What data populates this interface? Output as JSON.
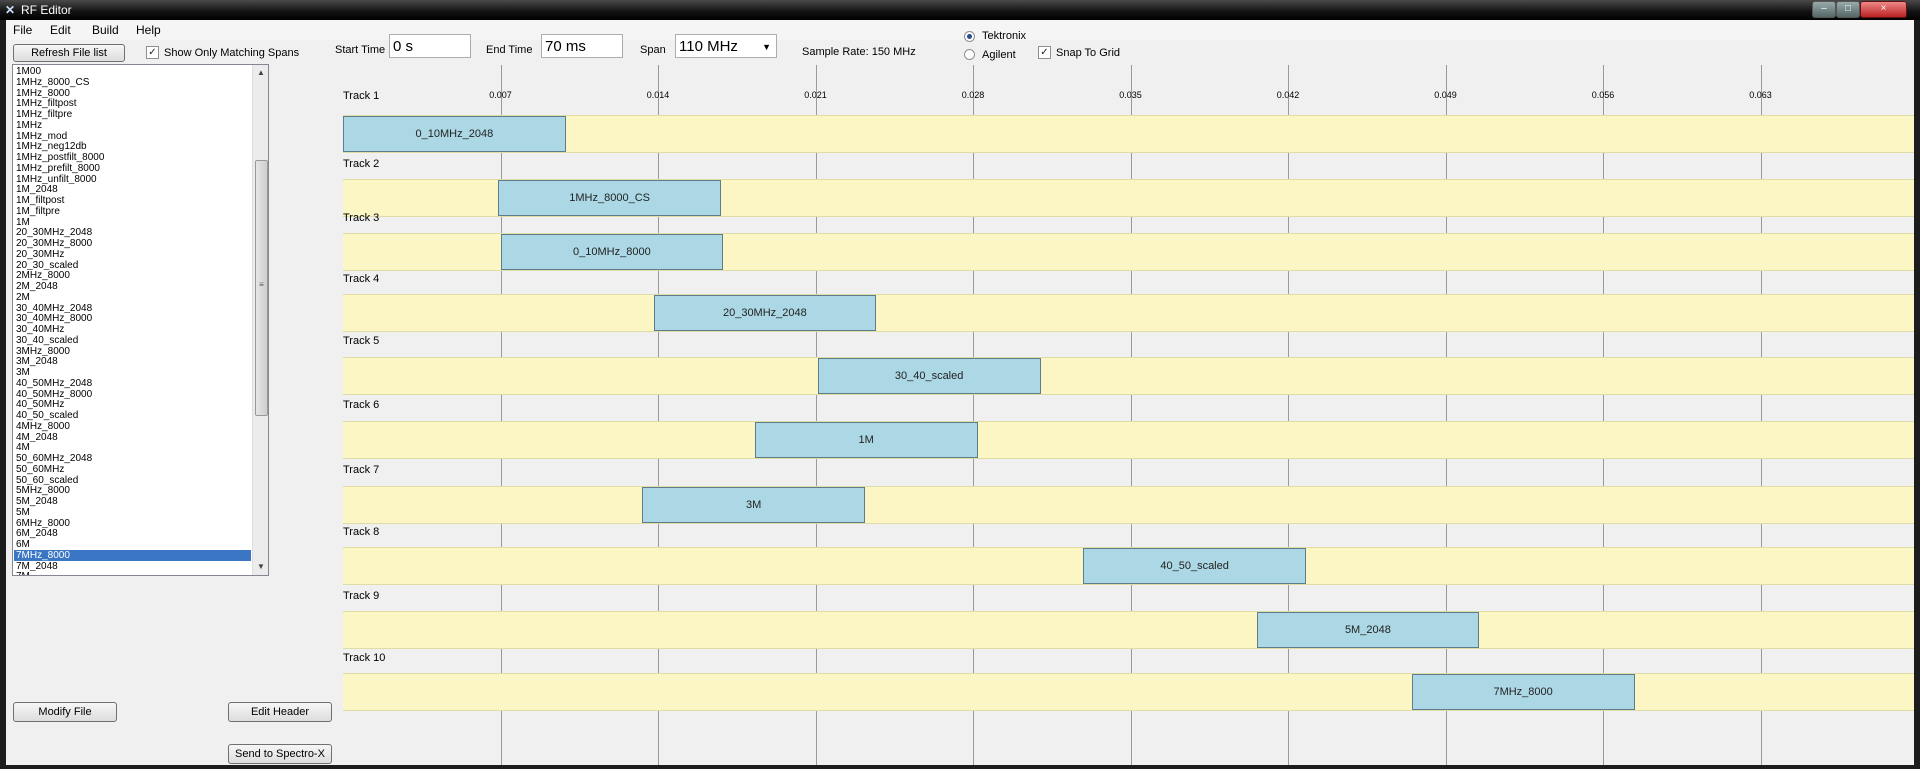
{
  "window": {
    "title": "RF Editor",
    "app_icon": "rf-app-icon",
    "controls": {
      "minimize": "–",
      "maximize": "□",
      "close": "×"
    }
  },
  "menu": {
    "items": [
      "File",
      "Edit",
      "Build",
      "Help"
    ]
  },
  "toolbar": {
    "refresh_label": "Refresh File list",
    "show_matching_label": "Show Only Matching Spans",
    "show_matching_checked": true,
    "start_time_label": "Start Time",
    "start_time_value": "0 s",
    "end_time_label": "End Time",
    "end_time_value": "70 ms",
    "span_label": "Span",
    "span_value": "110 MHz",
    "sample_rate_label": "Sample Rate: 150 MHz",
    "radio_tektronix": "Tektronix",
    "radio_agilent": "Agilent",
    "selected_vendor": "Tektronix",
    "snap_label": "Snap To Grid",
    "snap_checked": true
  },
  "file_list": {
    "items": [
      "1M00",
      "1MHz_8000_CS",
      "1MHz_8000",
      "1MHz_filtpost",
      "1MHz_filtpre",
      "1MHz",
      "1MHz_mod",
      "1MHz_neg12db",
      "1MHz_postfilt_8000",
      "1MHz_prefilt_8000",
      "1MHz_unfilt_8000",
      "1M_2048",
      "1M_filtpost",
      "1M_filtpre",
      "1M",
      "20_30MHz_2048",
      "20_30MHz_8000",
      "20_30MHz",
      "20_30_scaled",
      "2MHz_8000",
      "2M_2048",
      "2M",
      "30_40MHz_2048",
      "30_40MHz_8000",
      "30_40MHz",
      "30_40_scaled",
      "3MHz_8000",
      "3M_2048",
      "3M",
      "40_50MHz_2048",
      "40_50MHz_8000",
      "40_50MHz",
      "40_50_scaled",
      "4MHz_8000",
      "4M_2048",
      "4M",
      "50_60MHz_2048",
      "50_60MHz",
      "50_60_scaled",
      "5MHz_8000",
      "5M_2048",
      "5M",
      "6MHz_8000",
      "6M_2048",
      "6M",
      "7MHz_8000",
      "7M_2048",
      "7M"
    ],
    "selected": "7MHz_8000"
  },
  "buttons": {
    "modify_file": "Modify File",
    "edit_header": "Edit Header",
    "send": "Send to Spectro-X"
  },
  "timeline": {
    "start_s": 0,
    "end_s": 0.07,
    "tick_labels": [
      "0.007",
      "0.014",
      "0.021",
      "0.028",
      "0.035",
      "0.042",
      "0.049",
      "0.056",
      "0.063"
    ],
    "tracks": [
      {
        "label": "Track 1",
        "clip": "0_10MHz_2048",
        "start_s": 0.0,
        "end_s": 0.0099
      },
      {
        "label": "Track 2",
        "clip": "1MHz_8000_CS",
        "start_s": 0.0069,
        "end_s": 0.0168
      },
      {
        "label": "Track 3",
        "clip": "0_10MHz_8000",
        "start_s": 0.007,
        "end_s": 0.0169
      },
      {
        "label": "Track 4",
        "clip": "20_30MHz_2048",
        "start_s": 0.0138,
        "end_s": 0.0237
      },
      {
        "label": "Track 5",
        "clip": "30_40_scaled",
        "start_s": 0.0211,
        "end_s": 0.031
      },
      {
        "label": "Track 6",
        "clip": "1M",
        "start_s": 0.0183,
        "end_s": 0.0282
      },
      {
        "label": "Track 7",
        "clip": "3M",
        "start_s": 0.0133,
        "end_s": 0.0232
      },
      {
        "label": "Track 8",
        "clip": "40_50_scaled",
        "start_s": 0.0329,
        "end_s": 0.0428
      },
      {
        "label": "Track 9",
        "clip": "5M_2048",
        "start_s": 0.0406,
        "end_s": 0.0505
      },
      {
        "label": "Track 10",
        "clip": "7MHz_8000",
        "start_s": 0.0475,
        "end_s": 0.0574
      }
    ]
  }
}
